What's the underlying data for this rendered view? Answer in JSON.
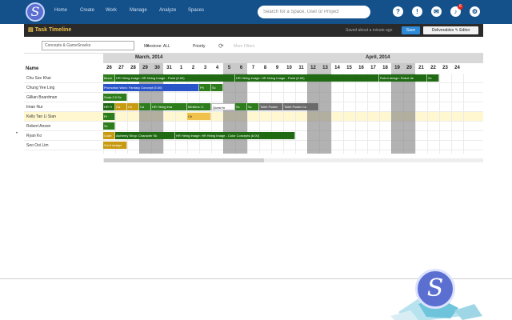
{
  "app": {
    "logo_letter": "S"
  },
  "nav": {
    "items": [
      "Home",
      "Create",
      "Work",
      "Manage",
      "Analyze",
      "Spaces"
    ]
  },
  "search": {
    "placeholder": "Search for a Space, User or Project"
  },
  "icons": [
    "help-icon",
    "info-icon",
    "mail-icon",
    "bell-icon",
    "settings-icon"
  ],
  "notifications": {
    "count": "6"
  },
  "toolbar": {
    "title": "Task Timeline",
    "saved": "Saved about a minute ago",
    "save_label": "Save",
    "view_label": "Deliverables  ✎ Editor"
  },
  "filters": {
    "search_value": "Concepts & GameSnacks",
    "milestone": "Milestone: ALL",
    "priority": "Priority",
    "dimmed": "More Filters"
  },
  "timeline": {
    "name_header": "Name",
    "months": [
      "March, 2014",
      "April, 2014"
    ],
    "days": [
      "26",
      "27",
      "28",
      "29",
      "30",
      "31",
      "1",
      "2",
      "3",
      "4",
      "5",
      "6",
      "7",
      "8",
      "9",
      "10",
      "11",
      "12",
      "13",
      "14",
      "15",
      "16",
      "17",
      "18",
      "19",
      "20",
      "21",
      "22",
      "23",
      "24"
    ],
    "weekend_days": [
      3,
      4,
      10,
      11,
      17,
      18,
      24,
      25
    ],
    "rows": [
      {
        "name": "Chu Sze Khai",
        "bars": [
          {
            "label": "Moon",
            "color": "#2e7d1c",
            "start": 0,
            "span": 1
          },
          {
            "label": "HR Hiring Image: HR Hiring Image - Paint (6.50)",
            "color": "#1f6a12",
            "start": 1,
            "span": 10
          },
          {
            "label": "HR Hiring Image: HR Hiring Image - Paint (6.50)",
            "color": "#1f6a12",
            "start": 11,
            "span": 12
          },
          {
            "label": "Robot design: Robot de",
            "color": "#1f6a12",
            "start": 23,
            "span": 4
          },
          {
            "label": "Sc",
            "color": "#1f6a12",
            "start": 27,
            "span": 1
          }
        ]
      },
      {
        "name": "Chung Yee Ling",
        "bars": [
          {
            "label": "Promotion Work: Fantasy Concept (5.50)",
            "color": "#2a55c8",
            "start": 0,
            "span": 8
          },
          {
            "label": "Ph",
            "color": "#2e7d1c",
            "start": 8,
            "span": 1
          },
          {
            "label": "Sc",
            "color": "#2e7d1c",
            "start": 9,
            "span": 1
          }
        ]
      },
      {
        "name": "Gillian Boardman",
        "bars": [
          {
            "label": "Soda 2.0 Sc",
            "color": "#2e7d1c",
            "start": 0,
            "span": 2
          }
        ]
      },
      {
        "name": "Iman Nur",
        "bars": [
          {
            "label": "HR H",
            "color": "#1f6a12",
            "start": 0,
            "span": 1
          },
          {
            "label": "Ca",
            "color": "#c79a12",
            "start": 1,
            "span": 1
          },
          {
            "label": "Co",
            "color": "#c79a12",
            "start": 2,
            "span": 1
          },
          {
            "label": "Ca",
            "color": "#2e7d1c",
            "start": 3,
            "span": 1
          },
          {
            "label": "HR Hiring Ima",
            "color": "#2e7d1c",
            "start": 4,
            "span": 3
          },
          {
            "label": "Minikins: C",
            "color": "#2e7d1c",
            "start": 7,
            "span": 2
          },
          {
            "label": "Quest fo",
            "color": "#ffffff",
            "start": 9,
            "span": 2
          },
          {
            "label": "Sc",
            "color": "#2e7d1c",
            "start": 11,
            "span": 1
          },
          {
            "label": "Sc",
            "color": "#2e7d1c",
            "start": 12,
            "span": 1
          },
          {
            "label": "Toilet Poster",
            "color": "#6a6a6a",
            "start": 13,
            "span": 2
          },
          {
            "label": "Toilet Poster Co",
            "color": "#6a6a6a",
            "start": 15,
            "span": 3
          }
        ]
      },
      {
        "name": "Kelly Tan Li Sian",
        "bars": [
          {
            "label": "Pr",
            "color": "#2e7d1c",
            "start": 0,
            "span": 1
          },
          {
            "label": "Ch",
            "color": "#f0c24b",
            "start": 7,
            "span": 2
          }
        ]
      },
      {
        "name": "Robert Anson",
        "bars": [
          {
            "label": "Sc",
            "color": "#2e7d1c",
            "start": 0,
            "span": 1
          }
        ]
      },
      {
        "name": "Ryan Ko",
        "bars": [
          {
            "label": "Code",
            "color": "#c79a12",
            "start": 0,
            "span": 1
          },
          {
            "label": "Alchemy Shop: Character Sk",
            "color": "#1f6a12",
            "start": 1,
            "span": 5
          },
          {
            "label": "HR Hiring Image: HR Hiring Image - Color Concepts (8.00)",
            "color": "#1f6a12",
            "start": 6,
            "span": 10
          }
        ]
      },
      {
        "name": "Seo Ooi Lim",
        "bars": [
          {
            "label": "Sci-fi design",
            "color": "#c79a12",
            "start": 0,
            "span": 2
          }
        ]
      }
    ]
  }
}
